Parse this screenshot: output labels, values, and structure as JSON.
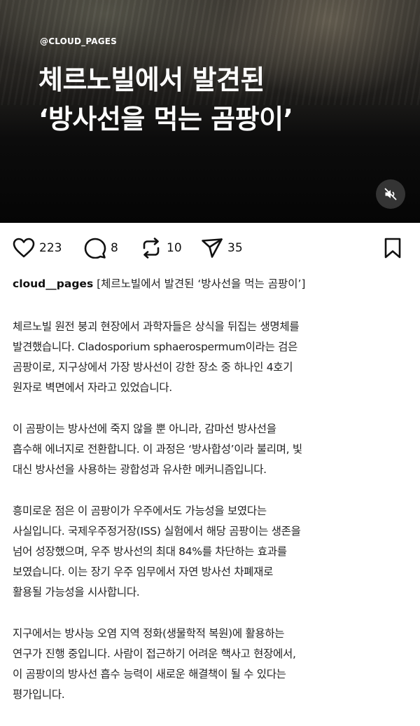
{
  "video": {
    "handle": "@CLOUD_PAGES",
    "title_lines": [
      "체르노빌에서 발견된",
      "‘방사선을 먹는 곰팡이’"
    ],
    "mute_icon": "speaker-muted-icon"
  },
  "actions": {
    "likes": "223",
    "comments": "8",
    "reposts": "10",
    "shares": "35"
  },
  "caption": {
    "username": "cloud__pages",
    "text": "[체르노빌에서 발견된 ‘방사선을 먹는 곰팡이’]"
  },
  "body": {
    "paragraphs": [
      [
        "체르노빌 원전 붕괴 현장에서 과학자들은 상식을 뒤집는 생명체를",
        "발견했습니다. Cladosporium sphaerospermum이라는 검은",
        "곰팡이로, 지구상에서 가장 방사선이 강한 장소 중 하나인 4호기",
        "원자로 벽면에서 자라고 있었습니다."
      ],
      [
        "이 곰팡이는 방사선에 죽지 않을 뿐 아니라, 감마선 방사선을",
        "흡수해 에너지로 전환합니다. 이 과정은 ‘방사합성’이라 불리며, 빛",
        "대신 방사선을 사용하는 광합성과 유사한 메커니즘입니다."
      ],
      [
        "흥미로운 점은 이 곰팡이가 우주에서도 가능성을 보였다는",
        "사실입니다. 국제우주정거장(ISS) 실험에서 해당 곰팡이는 생존을",
        "넘어 성장했으며, 우주 방사선의 최대 84%를 차단하는 효과를",
        "보였습니다. 이는 장기 우주 임무에서 자연 방사선 차폐재로",
        "활용될 가능성을 시사합니다."
      ],
      [
        "지구에서는 방사능 오염 지역 정화(생물학적 복원)에 활용하는",
        "연구가 진행 중입니다. 사람이 접근하기 어려운 핵사고 현장에서,",
        "이 곰팡이의 방사선 흡수 능력이 새로운 해결책이 될 수 있다는",
        "평가입니다."
      ]
    ]
  }
}
